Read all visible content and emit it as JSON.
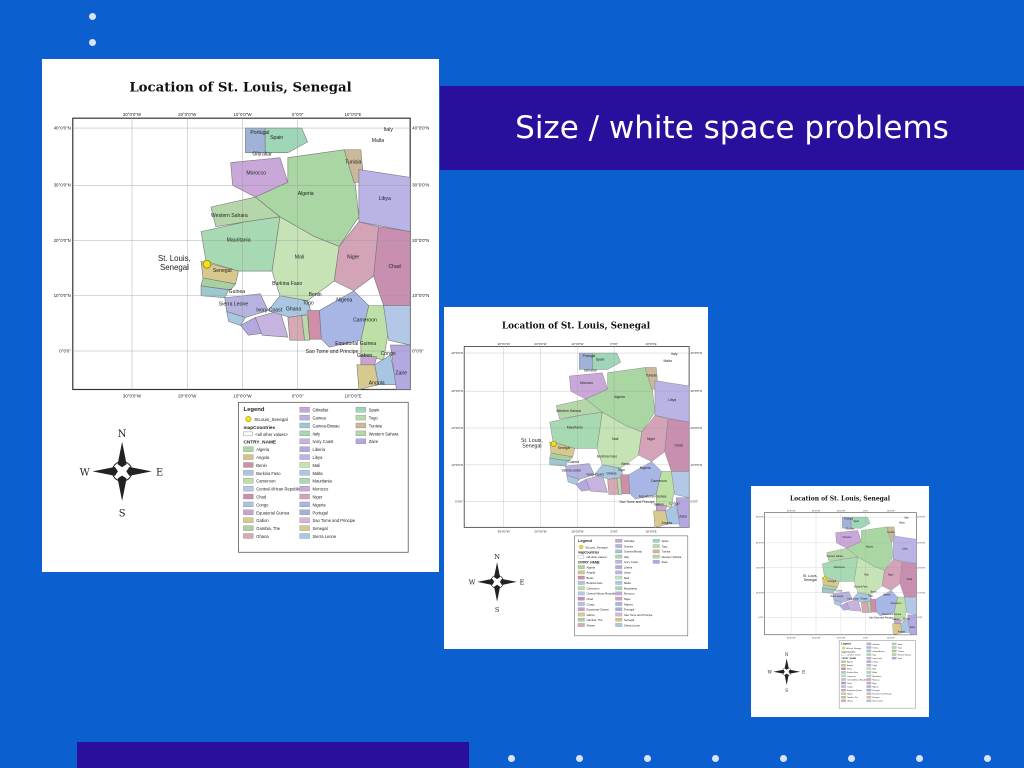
{
  "slide": {
    "title": "Size / white space problems"
  },
  "map": {
    "title": "Location of St. Louis, Senegal",
    "site_label_line1": "St. Louis,",
    "site_label_line2": "Senegal",
    "compass": {
      "n": "N",
      "s": "S",
      "e": "E",
      "w": "W"
    },
    "lon_ticks": [
      "30°0'0\"W",
      "20°0'0\"W",
      "10°0'0\"W",
      "0°0'0\"",
      "10°0'0\"E"
    ],
    "lat_ticks": [
      "40°0'0\"N",
      "30°0'0\"N",
      "20°0'0\"N",
      "10°0'0\"N",
      "0°0'0\""
    ],
    "countries": [
      {
        "name": "Portugal",
        "color": "#9fb3d6"
      },
      {
        "name": "Spain",
        "color": "#9fd6b8"
      },
      {
        "name": "Gibraltar",
        "color": "#c7a6d9"
      },
      {
        "name": "Morocco",
        "color": "#c9a7d9"
      },
      {
        "name": "Algeria",
        "color": "#a9d6a3"
      },
      {
        "name": "Tunisia",
        "color": "#c9b89a"
      },
      {
        "name": "Libya",
        "color": "#b9b3e6"
      },
      {
        "name": "Western Sahara",
        "color": "#b4d6a8"
      },
      {
        "name": "Mauritania",
        "color": "#a7d9b3"
      },
      {
        "name": "Mali",
        "color": "#c5e3b5"
      },
      {
        "name": "Niger",
        "color": "#d3a3b8"
      },
      {
        "name": "Chad",
        "color": "#c98fb0"
      },
      {
        "name": "Senegal",
        "color": "#d7c98e"
      },
      {
        "name": "Gambia, The",
        "color": "#a9d0a0"
      },
      {
        "name": "Guinea-Bissau",
        "color": "#9fc7cf"
      },
      {
        "name": "Guinea",
        "color": "#b6b3e0"
      },
      {
        "name": "Sierra Leone",
        "color": "#a6c8e3"
      },
      {
        "name": "Liberia",
        "color": "#b4a9de"
      },
      {
        "name": "Ivory Coast",
        "color": "#c6b3e0"
      },
      {
        "name": "Burkina Faso",
        "color": "#a9c7e0"
      },
      {
        "name": "Ghana",
        "color": "#d6a9b3"
      },
      {
        "name": "Togo",
        "color": "#b9d9a9"
      },
      {
        "name": "Benin",
        "color": "#cf8fa8"
      },
      {
        "name": "Nigeria",
        "color": "#a8b6e6"
      },
      {
        "name": "Cameroon",
        "color": "#bde0a6"
      },
      {
        "name": "Equatorial Guinea",
        "color": "#c7a3cf"
      },
      {
        "name": "Sao Tome and Principe",
        "color": "#d9b3d6"
      },
      {
        "name": "Gabon",
        "color": "#d8c98f"
      },
      {
        "name": "Congo",
        "color": "#a8c6e3"
      },
      {
        "name": "Zaire",
        "color": "#b3a8e0"
      },
      {
        "name": "Angola",
        "color": "#d7c28c"
      },
      {
        "name": "Malta",
        "color": "#a9c9e6"
      },
      {
        "name": "Italy",
        "color": "#a9d6b3"
      },
      {
        "name": "Central African Republic",
        "color": "#b3c8e6"
      }
    ],
    "legend": {
      "title": "Legend",
      "site_entry": "StLouis_Senegal",
      "layer_name": "mapCountries",
      "other_values": "<all other values>",
      "field_name": "CNTRY_NAME",
      "col1": [
        "Algeria",
        "Angola",
        "Benin",
        "Burkina Faso",
        "Cameroon",
        "Central African Republic",
        "Chad",
        "Congo",
        "Equatorial Guinea",
        "Gabon",
        "Gambia, The",
        "Ghana"
      ],
      "col2": [
        "Gibraltar",
        "Guinea",
        "Guinea-Bissau",
        "Italy",
        "Ivory Coast",
        "Liberia",
        "Libya",
        "Mali",
        "Malta",
        "Mauritania",
        "Morocco",
        "Niger",
        "Nigeria",
        "Portugal",
        "Sao Tome and Principe",
        "Senegal",
        "Sierra Leone"
      ],
      "col3": [
        "Spain",
        "Togo",
        "Tunisia",
        "Western Sahara",
        "Zaire"
      ]
    }
  }
}
